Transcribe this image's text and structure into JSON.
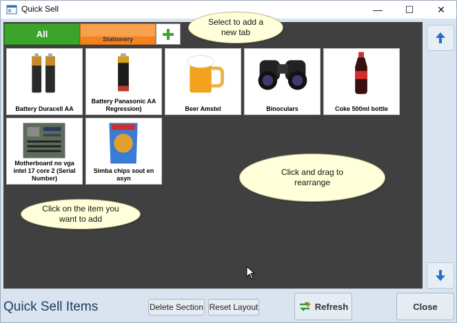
{
  "window": {
    "title": "Quick Sell",
    "minimize_glyph": "—",
    "maximize_glyph": "☐",
    "close_glyph": "✕"
  },
  "tabs": [
    {
      "label": "All",
      "color": "#3da42b"
    },
    {
      "label": "Stationery",
      "color": "#f58220"
    }
  ],
  "add_tab_icon": "plus-icon",
  "items": [
    {
      "label": "Battery Duracell AA",
      "icon": "battery-duracell-image"
    },
    {
      "label": "Battery Panasonic AA Regression)",
      "icon": "battery-panasonic-image"
    },
    {
      "label": "Beer Amstel",
      "icon": "beer-mug-image"
    },
    {
      "label": "Binoculars",
      "icon": "binoculars-image"
    },
    {
      "label": "Coke 500ml bottle",
      "icon": "coke-bottle-image"
    },
    {
      "label": "Motherboard no vga intel 17 core 2 (Serial Number)",
      "icon": "motherboard-image"
    },
    {
      "label": "Simba chips sout en asyn",
      "icon": "chips-bag-image"
    }
  ],
  "callouts": {
    "add_tab": "Select to add a new tab",
    "drag": "Click and drag to rearrange",
    "click_item": "Click on the item you want to add"
  },
  "footer": {
    "title": "Quick Sell Items",
    "delete_section": "Delete Section",
    "reset_layout": "Reset Layout",
    "refresh": "Refresh",
    "close": "Close"
  },
  "colors": {
    "panel_bg": "#404040",
    "window_bg": "#d9e4f0",
    "scroll_arrow": "#1e73c8"
  }
}
